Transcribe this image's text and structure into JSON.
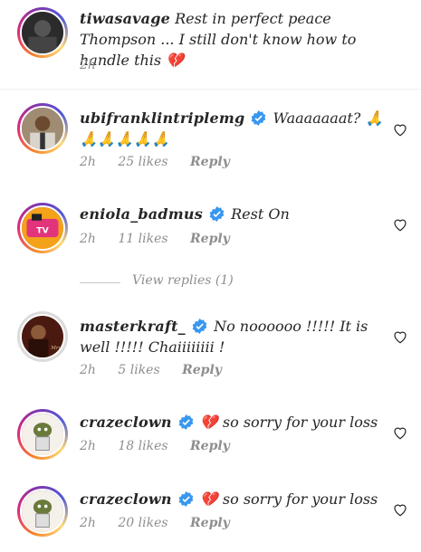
{
  "comments": [
    {
      "username": "tiwasavage",
      "verified": false,
      "text": "Rest in perfect peace Thompson ... I still don't know how to handle this 💔",
      "time": "2h",
      "likes": "",
      "reply_label": ""
    },
    {
      "username": "ubifranklintriplemg",
      "verified": true,
      "text": "Waaaaaaat? 🙏🙏🙏🙏🙏🙏",
      "time": "2h",
      "likes": "25 likes",
      "reply_label": "Reply"
    },
    {
      "username": "eniola_badmus",
      "verified": true,
      "text": "Rest On",
      "time": "2h",
      "likes": "11 likes",
      "reply_label": "Reply"
    },
    {
      "username": "masterkraft_",
      "verified": true,
      "text": "No noooooo !!!!! It is well !!!!! Chaiiiiiiii !",
      "time": "2h",
      "likes": "5 likes",
      "reply_label": "Reply"
    },
    {
      "username": "crazeclown",
      "verified": true,
      "text": "💔 so sorry for your loss",
      "time": "2h",
      "likes": "18 likes",
      "reply_label": "Reply"
    },
    {
      "username": "crazeclown",
      "verified": true,
      "text": "💔 so sorry for your loss",
      "time": "2h",
      "likes": "20 likes",
      "reply_label": "Reply"
    }
  ],
  "view_replies": "View replies (1)",
  "colors": {
    "verified": "#3897f0",
    "meta": "#8e8e8e",
    "text": "#262626"
  },
  "icons": {
    "like": "heart-outline-icon",
    "verified": "verified-badge-icon",
    "broken_heart": "broken-heart-emoji"
  }
}
